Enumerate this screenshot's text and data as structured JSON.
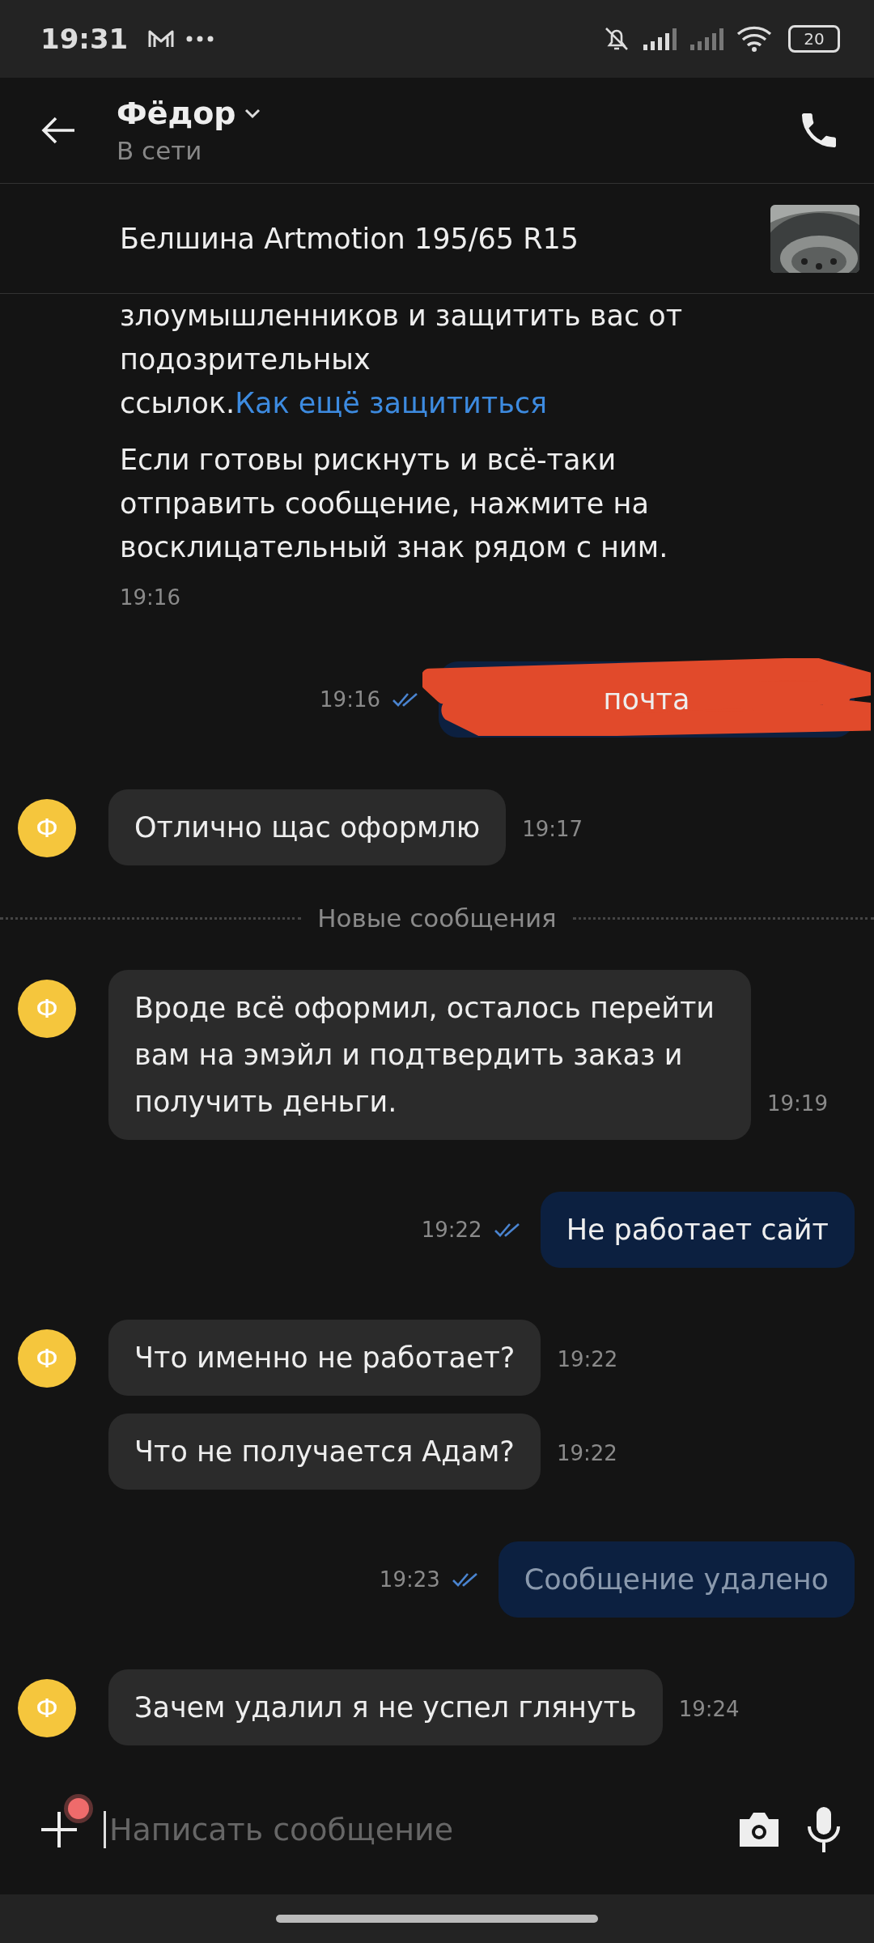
{
  "status_bar": {
    "time": "19:31",
    "battery": "20"
  },
  "header": {
    "name": "Фёдор",
    "status": "В сети"
  },
  "product": {
    "title": "Белшина Artmotion 195/65 R15"
  },
  "messages": [
    {
      "kind": "system",
      "paragraphs": [
        {
          "text": "злоумышленников и защитить вас от подозрительных ссылок.",
          "link": "Как ещё защититься"
        },
        {
          "text": "Если готовы рискнуть и всё-таки отправить сообщение, нажмите на восклицательный знак рядом с ним."
        }
      ],
      "time": "19:16"
    },
    {
      "kind": "outgoing",
      "text": "почта",
      "time": "19:16",
      "read": true,
      "deleted": false,
      "redacted": true
    },
    {
      "kind": "incoming",
      "text": "Отлично щас оформлю",
      "time": "19:17",
      "avatar": "Ф"
    },
    {
      "kind": "divider",
      "text": "Новые сообщения"
    },
    {
      "kind": "incoming",
      "text": "Вроде всё оформил, осталось перейти вам на эмэйл и подтвердить заказ и получить деньги.",
      "time": "19:19",
      "avatar": "Ф"
    },
    {
      "kind": "outgoing",
      "text": "Не работает сайт",
      "time": "19:22",
      "read": true,
      "deleted": false
    },
    {
      "kind": "incoming",
      "text": "Что именно не работает?",
      "time": "19:22",
      "avatar": "Ф"
    },
    {
      "kind": "incoming",
      "text": "Что не получается Адам?",
      "time": "19:22"
    },
    {
      "kind": "outgoing",
      "text": "Сообщение удалено",
      "time": "19:23",
      "read": true,
      "deleted": true
    },
    {
      "kind": "incoming",
      "text": "Зачем удалил я не успел глянуть",
      "time": "19:24",
      "avatar": "Ф"
    }
  ],
  "composer": {
    "placeholder": "Написать сообщение",
    "attach_badge": true
  }
}
